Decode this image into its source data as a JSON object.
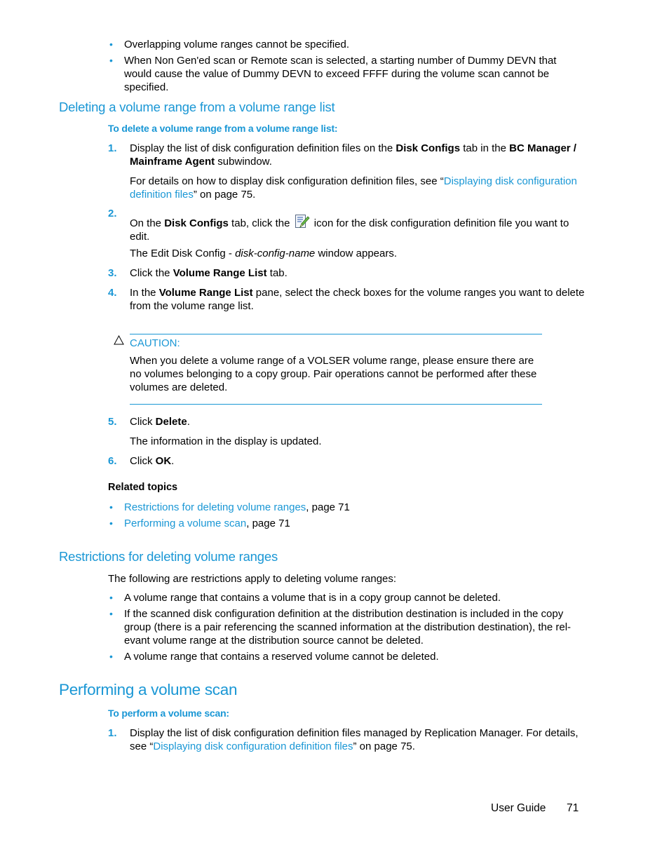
{
  "top_bullets": [
    "Overlapping volume ranges cannot be specified.",
    "When Non Gen'ed scan or Remote scan is selected, a starting number of Dummy DEVN that would cause the value of Dummy DEVN to exceed FFFF during the volume scan cannot be specified."
  ],
  "section_delete": {
    "heading": "Deleting a volume range from a volume range list",
    "procedure_title": "To delete a volume range from a volume range list:",
    "step1": {
      "num": "1.",
      "pre": "Display the list of disk configuration definition files on the ",
      "bold1": "Disk Configs",
      "mid": " tab in the ",
      "bold2": "BC Manager / Mainframe Agent",
      "post": " subwindow."
    },
    "step1_note": {
      "pre": "For details on how to display disk configuration definition files, see “",
      "link": "Displaying disk configuration definition files",
      "post": "” on page 75."
    },
    "step2": {
      "num": "2.",
      "pre": "On the ",
      "bold1": "Disk Configs",
      "mid": " tab, click the ",
      "icon": "edit-document-pencil-icon",
      "post": " icon for the disk configuration definition file you want to edit."
    },
    "step2_note": {
      "pre": "The Edit Disk Config - ",
      "italic": "disk-config-name",
      "post": " window appears."
    },
    "step3": {
      "num": "3.",
      "pre": "Click the ",
      "bold1": "Volume Range List",
      "post": " tab."
    },
    "step4": {
      "num": "4.",
      "pre": "In the ",
      "bold1": "Volume Range List",
      "post": " pane, select the check boxes for the volume ranges you want to delete from the volume range list."
    },
    "caution": {
      "icon": "warning-triangle-icon",
      "label": "CAUTION:",
      "text": "When you delete a volume range of a VOLSER volume range, please ensure there are no volumes belonging to a copy group. Pair operations cannot be performed after these volumes are deleted."
    },
    "step5": {
      "num": "5.",
      "pre": "Click ",
      "bold1": "Delete",
      "post": "."
    },
    "step5_note": "The information in the display is updated.",
    "step6": {
      "num": "6.",
      "pre": "Click ",
      "bold1": "OK",
      "post": "."
    },
    "related_title": "Related topics",
    "related": [
      {
        "link": "Restrictions for deleting volume ranges",
        "post": ", page 71"
      },
      {
        "link": "Performing a volume scan",
        "post": ", page 71"
      }
    ]
  },
  "section_restrictions": {
    "heading": "Restrictions for deleting volume ranges",
    "intro": "The following are restrictions apply to deleting volume ranges:",
    "bullets": [
      "A volume range that contains a volume that is in a copy group cannot be deleted.",
      "If the scanned disk configuration definition at the distribution destination is included in the copy group (there is a pair referencing the scanned information at the distribution destination), the rel-evant volume range at the distribution source cannot be deleted.",
      "A volume range that contains a reserved volume cannot be deleted."
    ]
  },
  "section_scan": {
    "heading": "Performing a volume scan",
    "procedure_title": "To perform a volume scan:",
    "step1": {
      "num": "1.",
      "pre": "Display the list of disk configuration definition files managed by Replication Manager. For details, see “",
      "link": "Displaying disk configuration definition files",
      "post": "” on page 75."
    }
  },
  "footer": {
    "label": "User Guide",
    "page": "71"
  },
  "colors": {
    "accent": "#1a97d5",
    "text": "#000000"
  }
}
